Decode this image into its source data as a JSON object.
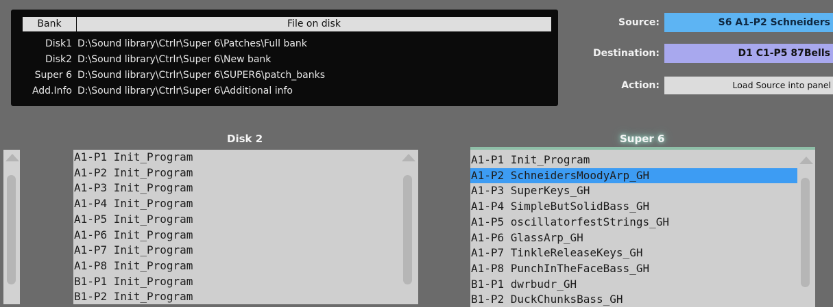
{
  "bank_table": {
    "header_bank": "Bank",
    "header_file": "File on disk",
    "rows": [
      {
        "bank": "Disk1",
        "path": "D:\\Sound library\\Ctrlr\\Super 6\\Patches\\Full bank"
      },
      {
        "bank": "Disk2",
        "path": "D:\\Sound library\\Ctrlr\\Super 6\\New bank"
      },
      {
        "bank": "Super 6",
        "path": "D:\\Sound library\\Ctrlr\\Super 6\\SUPER6\\patch_banks"
      },
      {
        "bank": "Add.Info",
        "path": "D:\\Sound library\\Ctrlr\\Super 6\\Additional info"
      }
    ]
  },
  "controls": {
    "source_label": "Source:",
    "source_value": "S6 A1-P2 Schneiders",
    "destination_label": "Destination:",
    "destination_value": "D1 C1-P5 87Bells",
    "action_label": "Action:",
    "action_value": "Load Source into panel"
  },
  "left_list": {
    "title": "Disk 2",
    "items": [
      "A1-P1 Init_Program",
      "A1-P2 Init_Program",
      "A1-P3 Init_Program",
      "A1-P4 Init_Program",
      "A1-P5 Init_Program",
      "A1-P6 Init_Program",
      "A1-P7 Init_Program",
      "A1-P8 Init_Program",
      "B1-P1 Init_Program",
      "B1-P2 Init_Program"
    ]
  },
  "right_list": {
    "title": "Super 6",
    "selected_index": 1,
    "items": [
      "A1-P1 Init_Program",
      "A1-P2 SchneidersMoodyArp_GH",
      "A1-P3 SuperKeys_GH",
      "A1-P4 SimpleButSolidBass_GH",
      "A1-P5 oscillatorfestStrings_GH",
      "A1-P6 GlassArp_GH",
      "A1-P7 TinkleReleaseKeys_GH",
      "A1-P8 PunchInTheFaceBass_GH",
      "B1-P1 dwrbudr_GH",
      "B1-P2 DuckChunksBass_GH"
    ]
  },
  "colors": {
    "background": "#6b6b6b",
    "source_field": "#5db4f3",
    "destination_field": "#a8a8ee",
    "selection": "#3d9cf3"
  }
}
